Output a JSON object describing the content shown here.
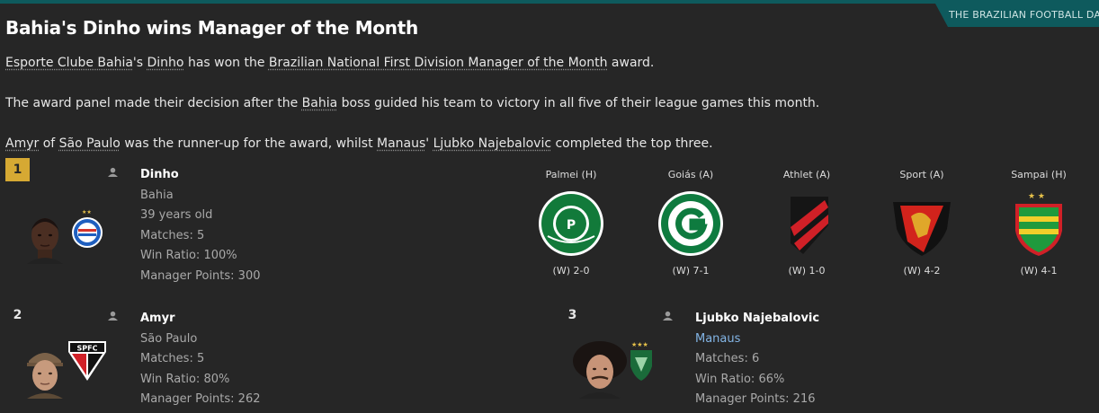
{
  "header": {
    "source_tab": "THE BRAZILIAN FOOTBALL DAIL",
    "headline": "Bahia's Dinho wins Manager of the Month"
  },
  "article": {
    "p1": {
      "club_link": "Esporte Clube Bahia",
      "text1": "'s ",
      "manager_link": "Dinho",
      "text2": " has won the ",
      "competition_link": "Brazilian National First Division Manager of the Month",
      "text3": " award."
    },
    "p2": {
      "text1": "The award panel made their decision after the ",
      "club_link": "Bahia",
      "text2": " boss guided his team to victory in all five of their league games this month."
    },
    "p3": {
      "link1": "Amyr",
      "text1": " of ",
      "link2": "São Paulo",
      "text2": " was the runner-up for the award, whilst ",
      "link3": "Manaus",
      "text3": "' ",
      "link4": "Ljubko Najebalovic",
      "text4": " completed the top three."
    }
  },
  "winners": [
    {
      "rank": "1",
      "name": "Dinho",
      "club": "Bahia",
      "age": "39 years old",
      "matches": "Matches: 5",
      "win_ratio": "Win Ratio: 100%",
      "points": "Manager Points: 300",
      "crest_icon": "bahia-crest-icon",
      "color": "#d6a933"
    },
    {
      "rank": "2",
      "name": "Amyr",
      "club": "São Paulo",
      "matches": "Matches: 5",
      "win_ratio": "Win Ratio: 80%",
      "points": "Manager Points: 262",
      "crest_icon": "sao-paulo-crest-icon"
    },
    {
      "rank": "3",
      "name": "Ljubko Najebalovic",
      "club": "Manaus",
      "matches": "Matches: 6",
      "win_ratio": "Win Ratio: 66%",
      "points": "Manager Points: 216",
      "crest_icon": "manaus-crest-icon"
    }
  ],
  "fixtures": [
    {
      "opponent": "Palmei (H)",
      "result": "(W) 2-0",
      "crest_icon": "palmeiras-crest-icon"
    },
    {
      "opponent": "Goiás (A)",
      "result": "(W) 7-1",
      "crest_icon": "goias-crest-icon"
    },
    {
      "opponent": "Athlet (A)",
      "result": "(W) 1-0",
      "crest_icon": "athletico-crest-icon"
    },
    {
      "opponent": "Sport (A)",
      "result": "(W) 4-2",
      "crest_icon": "sport-crest-icon"
    },
    {
      "opponent": "Sampai (H)",
      "result": "(W) 4-1",
      "crest_icon": "sampaio-crest-icon"
    }
  ]
}
